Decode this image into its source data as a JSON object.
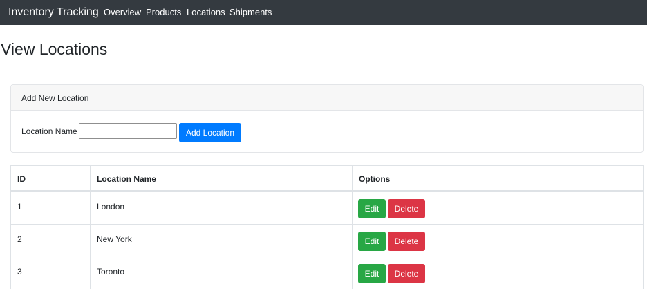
{
  "navbar": {
    "brand": "Inventory Tracking",
    "links": [
      "Overview",
      "Products",
      "Locations",
      "Shipments"
    ]
  },
  "page_title": "View Locations",
  "add_card": {
    "header": "Add New Location",
    "field_label": "Location Name",
    "field_value": "",
    "button_label": "Add Location"
  },
  "table": {
    "columns": [
      "ID",
      "Location Name",
      "Options"
    ],
    "rows": [
      {
        "id": "1",
        "name": "London",
        "edit_label": "Edit",
        "delete_label": "Delete"
      },
      {
        "id": "2",
        "name": "New York",
        "edit_label": "Edit",
        "delete_label": "Delete"
      },
      {
        "id": "3",
        "name": "Toronto",
        "edit_label": "Edit",
        "delete_label": "Delete"
      }
    ]
  },
  "colors": {
    "navbar": "#343a40",
    "primary": "#007bff",
    "success": "#28a745",
    "danger": "#dc3545"
  }
}
